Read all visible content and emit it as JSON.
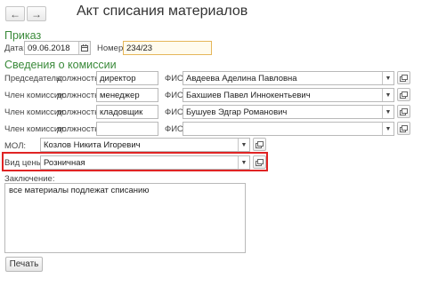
{
  "window": {
    "title": "Акт списания материалов",
    "back_icon": "←",
    "forward_icon": "→"
  },
  "order": {
    "section_label": "Приказ",
    "date_label": "Дата:",
    "date_value": "09.06.2018",
    "number_label": "Номер:",
    "number_value": "234/23"
  },
  "commission": {
    "section_label": "Сведения о комиссии",
    "position_label": "должность:",
    "fio_label": "ФИО:",
    "members": [
      {
        "role": "Председатель:",
        "position": "директор",
        "fio": "Авдеева Аделина Павловна"
      },
      {
        "role": "Член комиссии:",
        "position": "менеджер",
        "fio": "Бахшиев Павел Иннокентьевич"
      },
      {
        "role": "Член комиссии:",
        "position": "кладовщик",
        "fio": "Бушуев Эдгар Романович"
      },
      {
        "role": "Член комиссии:",
        "position": "",
        "fio": ""
      }
    ]
  },
  "mol": {
    "label": "МОЛ:",
    "value": "Козлов Никита Игоревич"
  },
  "price_type": {
    "label": "Вид цены:",
    "value": "Розничная",
    "highlight_color": "#e02424"
  },
  "conclusion": {
    "label": "Заключение:",
    "text": "все материалы подлежат списанию"
  },
  "actions": {
    "print_label": "Печать"
  },
  "icons": {
    "dropdown": "▼",
    "calendar": "calendar-icon",
    "open": "open-form-icon"
  },
  "colors": {
    "section_green": "#3a8a3a",
    "number_field_highlight": "#e5b65a"
  }
}
